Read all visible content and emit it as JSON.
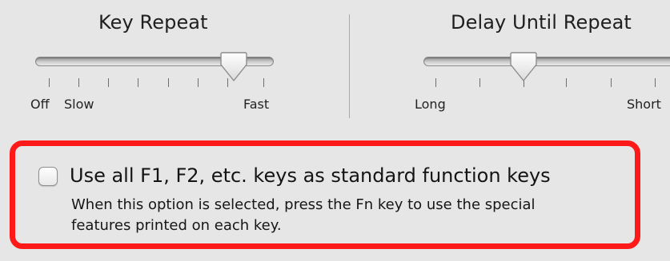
{
  "key_repeat": {
    "title": "Key Repeat",
    "labels": {
      "off": "Off",
      "slow": "Slow",
      "fast": "Fast"
    },
    "tick_count": 8,
    "selected_position_index": 7
  },
  "delay_until_repeat": {
    "title": "Delay Until Repeat",
    "labels": {
      "long": "Long",
      "short": "Short"
    },
    "tick_count": 6,
    "selected_position_index": 2
  },
  "function_keys_option": {
    "checked": false,
    "label": "Use all F1, F2, etc. keys as standard function keys",
    "description_line1": "When this option is selected, press the Fn key to use the special",
    "description_line2": "features printed on each key."
  },
  "colors": {
    "background": "#e6e6e6",
    "highlight_border": "#ff1a1a",
    "divider": "#a8a8a8"
  }
}
